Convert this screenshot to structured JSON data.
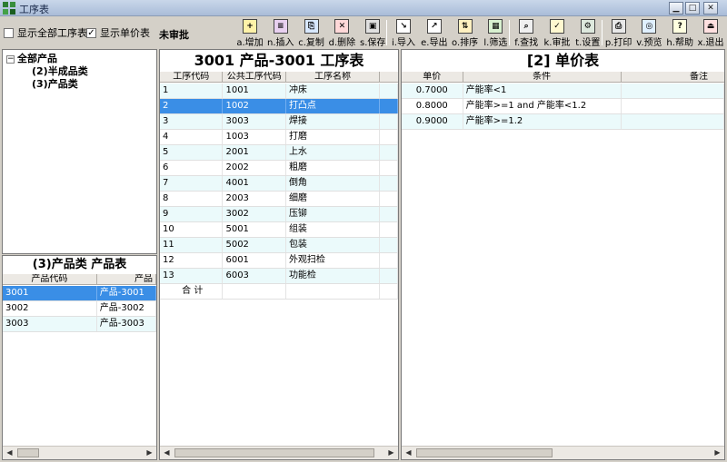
{
  "window": {
    "title": "工序表"
  },
  "toolbar": {
    "show_all_label": "显示全部工序表",
    "show_price_label": "显示单价表",
    "status": "未审批",
    "buttons": [
      {
        "key": "add",
        "label": "a.增加",
        "glyph": "+"
      },
      {
        "key": "insert",
        "label": "n.插入",
        "glyph": "≡"
      },
      {
        "key": "copy",
        "label": "c.复制",
        "glyph": "⎘"
      },
      {
        "key": "delete",
        "label": "d.删除",
        "glyph": "✕"
      },
      {
        "key": "save",
        "label": "s.保存",
        "glyph": "▣"
      },
      {
        "key": "import",
        "label": "i.导入",
        "glyph": "↘"
      },
      {
        "key": "export",
        "label": "e.导出",
        "glyph": "↗"
      },
      {
        "key": "sort",
        "label": "o.排序",
        "glyph": "⇅"
      },
      {
        "key": "filter",
        "label": "l.筛选",
        "glyph": "▦"
      },
      {
        "key": "find",
        "label": "f.查找",
        "glyph": "⌕"
      },
      {
        "key": "approve",
        "label": "k.审批",
        "glyph": "✓"
      },
      {
        "key": "settings",
        "label": "t.设置",
        "glyph": "⚙"
      },
      {
        "key": "print",
        "label": "p.打印",
        "glyph": "⎙"
      },
      {
        "key": "preview",
        "label": "v.预览",
        "glyph": "◎"
      },
      {
        "key": "help",
        "label": "h.帮助",
        "glyph": "?"
      },
      {
        "key": "exit",
        "label": "x.退出",
        "glyph": "⏏"
      }
    ]
  },
  "tree": {
    "root": "全部产品",
    "children": [
      "(2)半成品类",
      "(3)产品类"
    ]
  },
  "product_table": {
    "title": "(3)产品类 产品表",
    "columns": [
      "产品代码",
      "产品"
    ],
    "rows": [
      [
        "3001",
        "产品-3001"
      ],
      [
        "3002",
        "产品-3002"
      ],
      [
        "3003",
        "产品-3003"
      ]
    ]
  },
  "process_table": {
    "title": "3001 产品-3001 工序表",
    "columns": [
      "工序代码",
      "公共工序代码",
      "工序名称"
    ],
    "rows": [
      [
        "1",
        "1001",
        "冲床"
      ],
      [
        "2",
        "1002",
        "打凸点"
      ],
      [
        "3",
        "3003",
        "焊接"
      ],
      [
        "4",
        "1003",
        "打磨"
      ],
      [
        "5",
        "2001",
        "上水"
      ],
      [
        "6",
        "2002",
        "粗磨"
      ],
      [
        "7",
        "4001",
        "倒角"
      ],
      [
        "8",
        "2003",
        "细磨"
      ],
      [
        "9",
        "3002",
        "压铆"
      ],
      [
        "10",
        "5001",
        "组装"
      ],
      [
        "11",
        "5002",
        "包装"
      ],
      [
        "12",
        "6001",
        "外观扫检"
      ],
      [
        "13",
        "6003",
        "功能检"
      ]
    ],
    "total_label": "合  计"
  },
  "price_table": {
    "title": "[2] 单价表",
    "columns": [
      "单价",
      "条件",
      "备注"
    ],
    "rows": [
      [
        "0.7000",
        "产能率<1",
        ""
      ],
      [
        "0.8000",
        "产能率>=1 and 产能率<1.2",
        ""
      ],
      [
        "0.9000",
        "产能率>=1.2",
        ""
      ]
    ]
  }
}
